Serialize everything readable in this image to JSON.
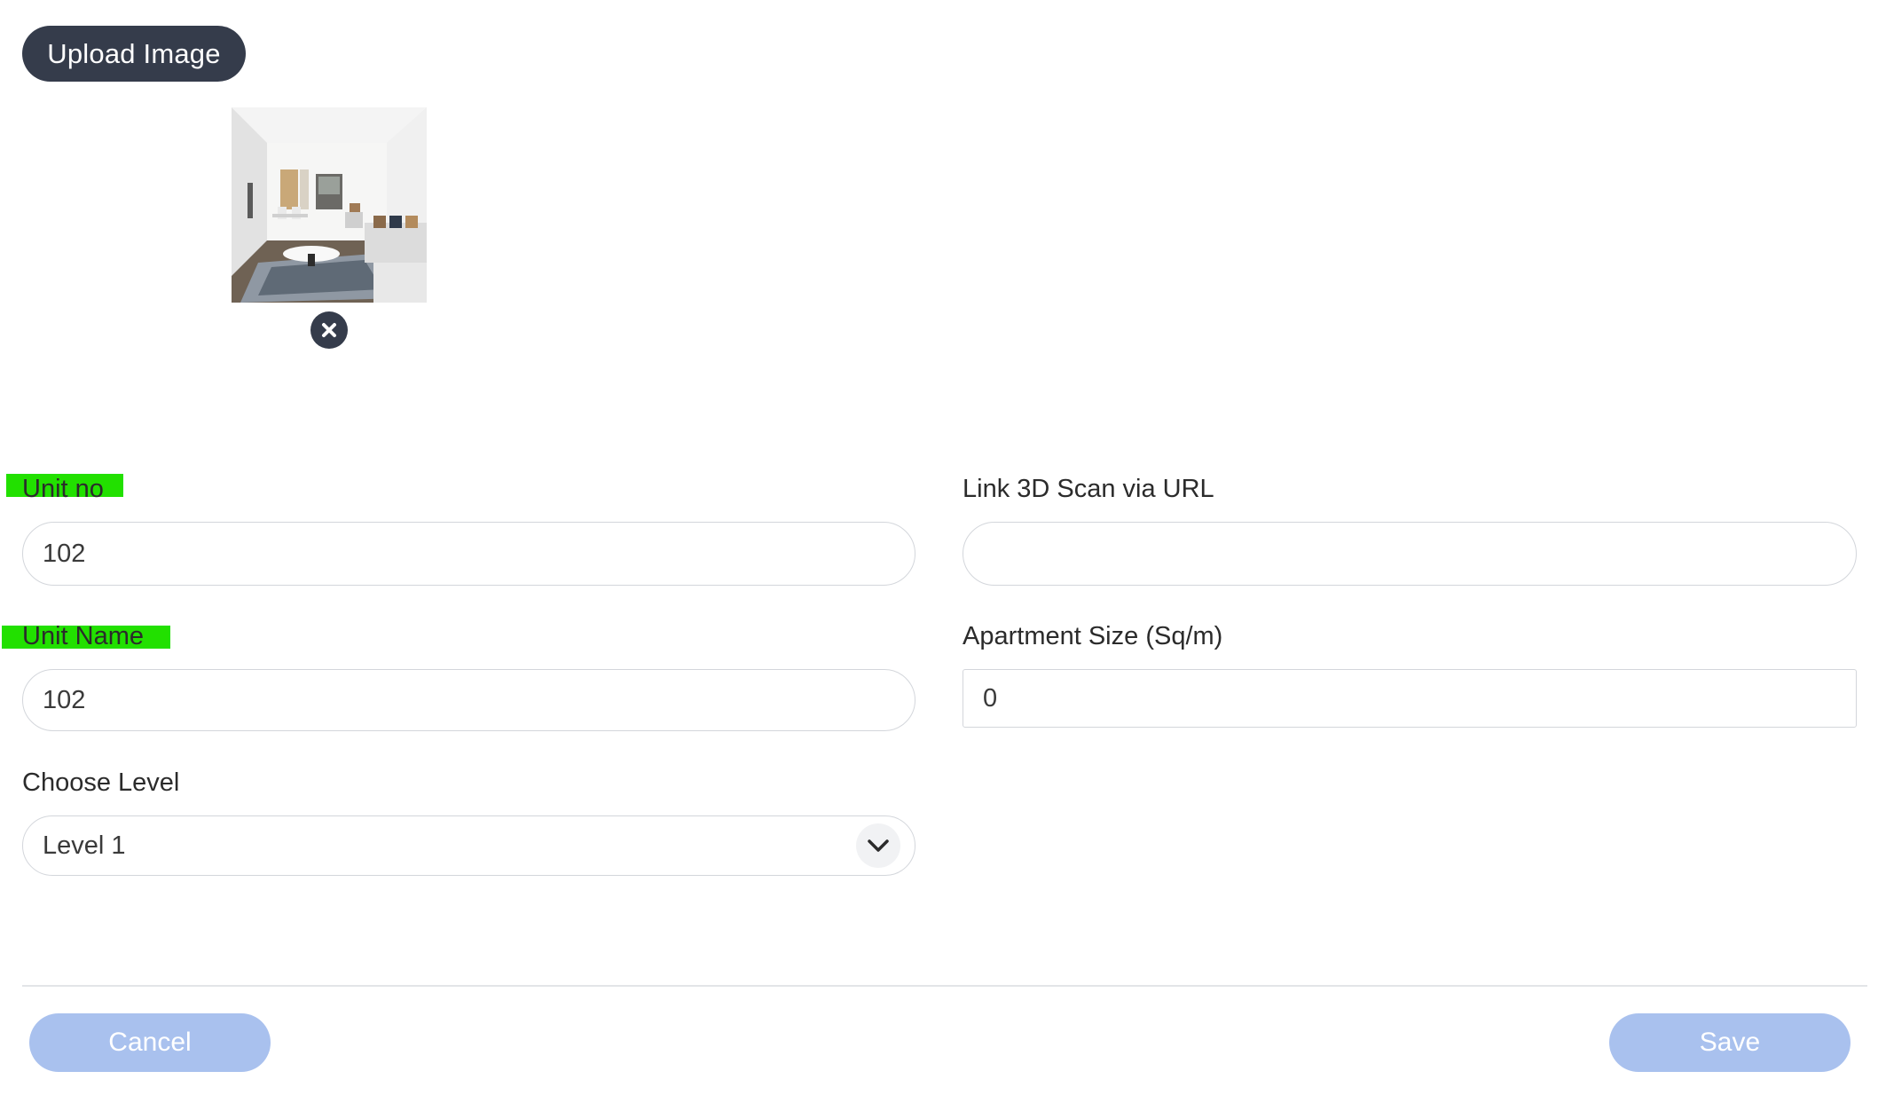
{
  "upload": {
    "label": "Upload Image"
  },
  "preview": {
    "remove_icon": "close-circle-icon"
  },
  "form": {
    "unit_no": {
      "label": "Unit no",
      "value": "102"
    },
    "unit_name": {
      "label": "Unit Name",
      "value": "102"
    },
    "choose_level": {
      "label": "Choose Level",
      "value": "Level 1",
      "icon": "chevron-down-icon"
    },
    "scan_url": {
      "label": "Link 3D Scan via URL",
      "value": ""
    },
    "apartment_size": {
      "label": "Apartment Size (Sq/m)",
      "value": "0"
    }
  },
  "footer": {
    "cancel_label": "Cancel",
    "save_label": "Save"
  },
  "colors": {
    "dark_button": "#353c4b",
    "footer_button": "#a9c1ee",
    "highlight": "#22e000"
  }
}
